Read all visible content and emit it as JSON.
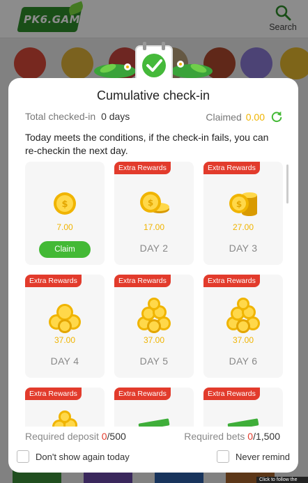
{
  "header": {
    "logo_text": "PK6.GAME",
    "search_label": "Search"
  },
  "modal": {
    "title": "Cumulative check-in",
    "total_checked_label": "Total checked-in",
    "total_checked_value": "0 days",
    "claimed_label": "Claimed",
    "claimed_value": "0.00",
    "notice": "Today meets the conditions, if the check-in fails, you can re-checkin the next day.",
    "days": [
      {
        "amount": "7.00",
        "label": "",
        "extra": "",
        "action": "Claim",
        "coin_icon": "single-coin-icon"
      },
      {
        "amount": "17.00",
        "label": "DAY 2",
        "extra": "Extra Rewards",
        "action": "",
        "coin_icon": "coin-pair-icon"
      },
      {
        "amount": "27.00",
        "label": "DAY 3",
        "extra": "Extra Rewards",
        "action": "",
        "coin_icon": "coin-stack-icon"
      },
      {
        "amount": "37.00",
        "label": "DAY 4",
        "extra": "Extra Rewards",
        "action": "",
        "coin_icon": "coin-pile-icon"
      },
      {
        "amount": "37.00",
        "label": "DAY 5",
        "extra": "Extra Rewards",
        "action": "",
        "coin_icon": "coin-pile-icon"
      },
      {
        "amount": "37.00",
        "label": "DAY 6",
        "extra": "Extra Rewards",
        "action": "",
        "coin_icon": "coin-pile-icon"
      },
      {
        "amount": "",
        "label": "",
        "extra": "Extra Rewards",
        "action": "",
        "coin_icon": "coin-pile-icon"
      },
      {
        "amount": "",
        "label": "",
        "extra": "Extra Rewards",
        "action": "",
        "coin_icon": "cash-stack-icon"
      },
      {
        "amount": "",
        "label": "",
        "extra": "Extra Rewards",
        "action": "",
        "coin_icon": "cash-stack-icon"
      }
    ],
    "required_deposit_label": "Required deposit",
    "required_deposit_current": "0",
    "required_deposit_total": "/500",
    "required_bets_label": "Required bets",
    "required_bets_current": "0",
    "required_bets_total": "/1,500",
    "dont_show_label": "Don't show again today",
    "never_remind_label": "Never remind"
  },
  "footer": {
    "tooltip_text": "Click to follow the"
  },
  "colors": {
    "accent_green": "#43b935",
    "extra_tag_red": "#e23b2c",
    "coin_gold": "#f0b400"
  }
}
